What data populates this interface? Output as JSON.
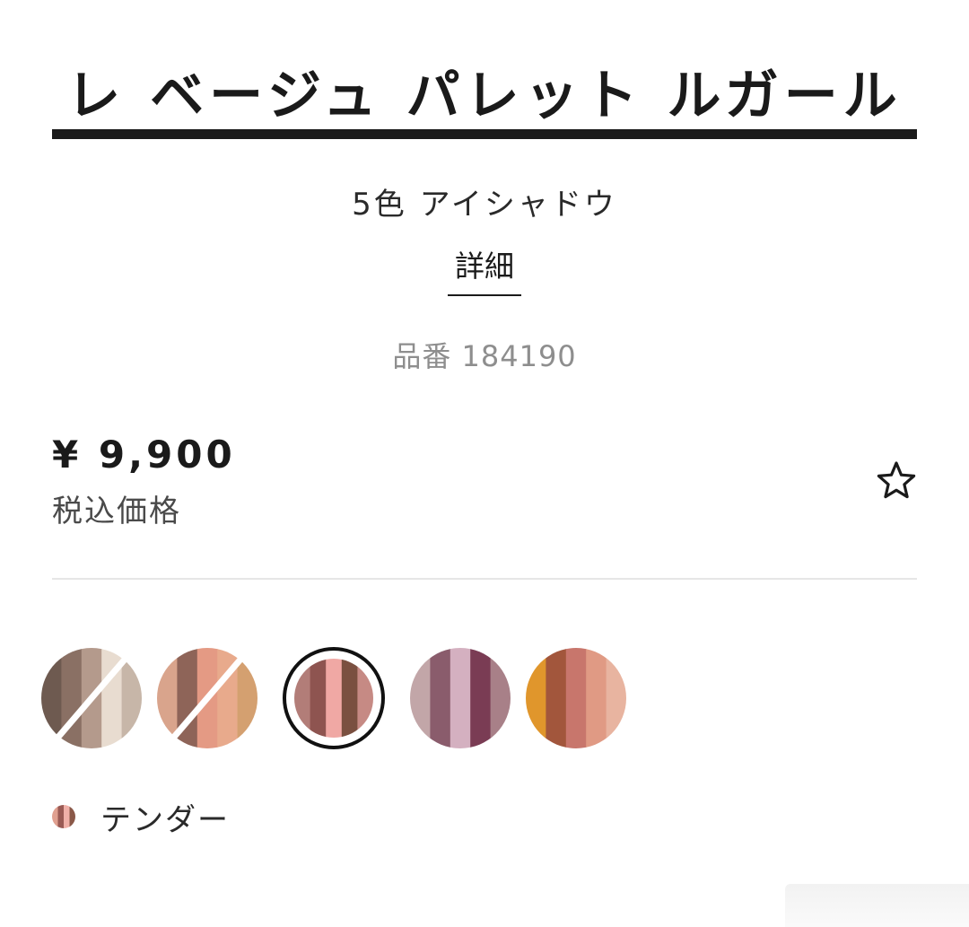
{
  "product": {
    "title": "レ ベージュ パレット ルガール",
    "subtitle": "5色 アイシャドウ",
    "details_link": "詳細",
    "product_number": "品番 184190",
    "price": "¥ 9,900",
    "tax_note": "税込価格"
  },
  "favorite": {
    "icon": "star-outline-icon"
  },
  "swatches": [
    {
      "name": "swatch-1",
      "sold_out": true,
      "selected": false,
      "colors": [
        "#6e5a50",
        "#8a7064",
        "#b49a8c",
        "#e8dcd0",
        "#c7b6a8"
      ]
    },
    {
      "name": "swatch-2",
      "sold_out": true,
      "selected": false,
      "colors": [
        "#d9a48c",
        "#8e6458",
        "#e49a84",
        "#e8aa8c",
        "#d4a070"
      ]
    },
    {
      "name": "swatch-3",
      "sold_out": false,
      "selected": true,
      "colors": [
        "#b27d78",
        "#8e5450",
        "#f0a8a4",
        "#7a5040",
        "#c68a84"
      ]
    },
    {
      "name": "swatch-4",
      "sold_out": false,
      "selected": false,
      "colors": [
        "#c2a6a8",
        "#8a5c6c",
        "#d4b0c0",
        "#7a3c54",
        "#a88088"
      ]
    },
    {
      "name": "swatch-5",
      "sold_out": false,
      "selected": false,
      "colors": [
        "#e0962c",
        "#a2563c",
        "#c8766c",
        "#e09a84",
        "#e8b4a0"
      ]
    }
  ],
  "selected_shade": {
    "name": "テンダー",
    "chip_colors": [
      "#e0a090",
      "#9a5a54",
      "#f0b0a8",
      "#8a5848"
    ]
  },
  "colors": {
    "text_primary": "#1a1a1a",
    "text_muted": "#8e8e8e",
    "rule": "#1a1a1a",
    "divider": "#e6e6e6"
  }
}
